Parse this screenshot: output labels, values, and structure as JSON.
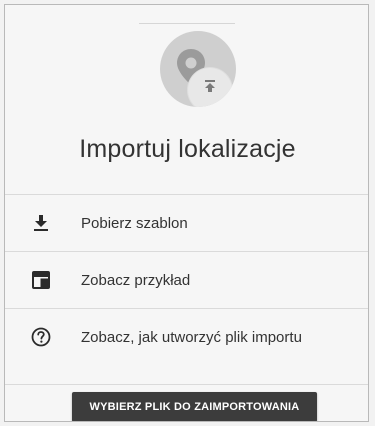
{
  "dialog": {
    "title": "Importuj lokalizacje",
    "illustration_icons": [
      "map-pin-icon",
      "upload-icon"
    ],
    "items": [
      {
        "icon": "download-icon",
        "label": "Pobierz szablon"
      },
      {
        "icon": "table-icon",
        "label": "Zobacz przykład"
      },
      {
        "icon": "help-circle-icon",
        "label": "Zobacz, jak utworzyć plik importu"
      }
    ],
    "primary_button": "WYBIERZ PLIK DO ZAIMPORTOWANIA"
  },
  "colors": {
    "background": "#f6f6f6",
    "text": "#333333",
    "button": "#3c3c3c",
    "button_text": "#ffffff",
    "divider": "#dadada"
  }
}
